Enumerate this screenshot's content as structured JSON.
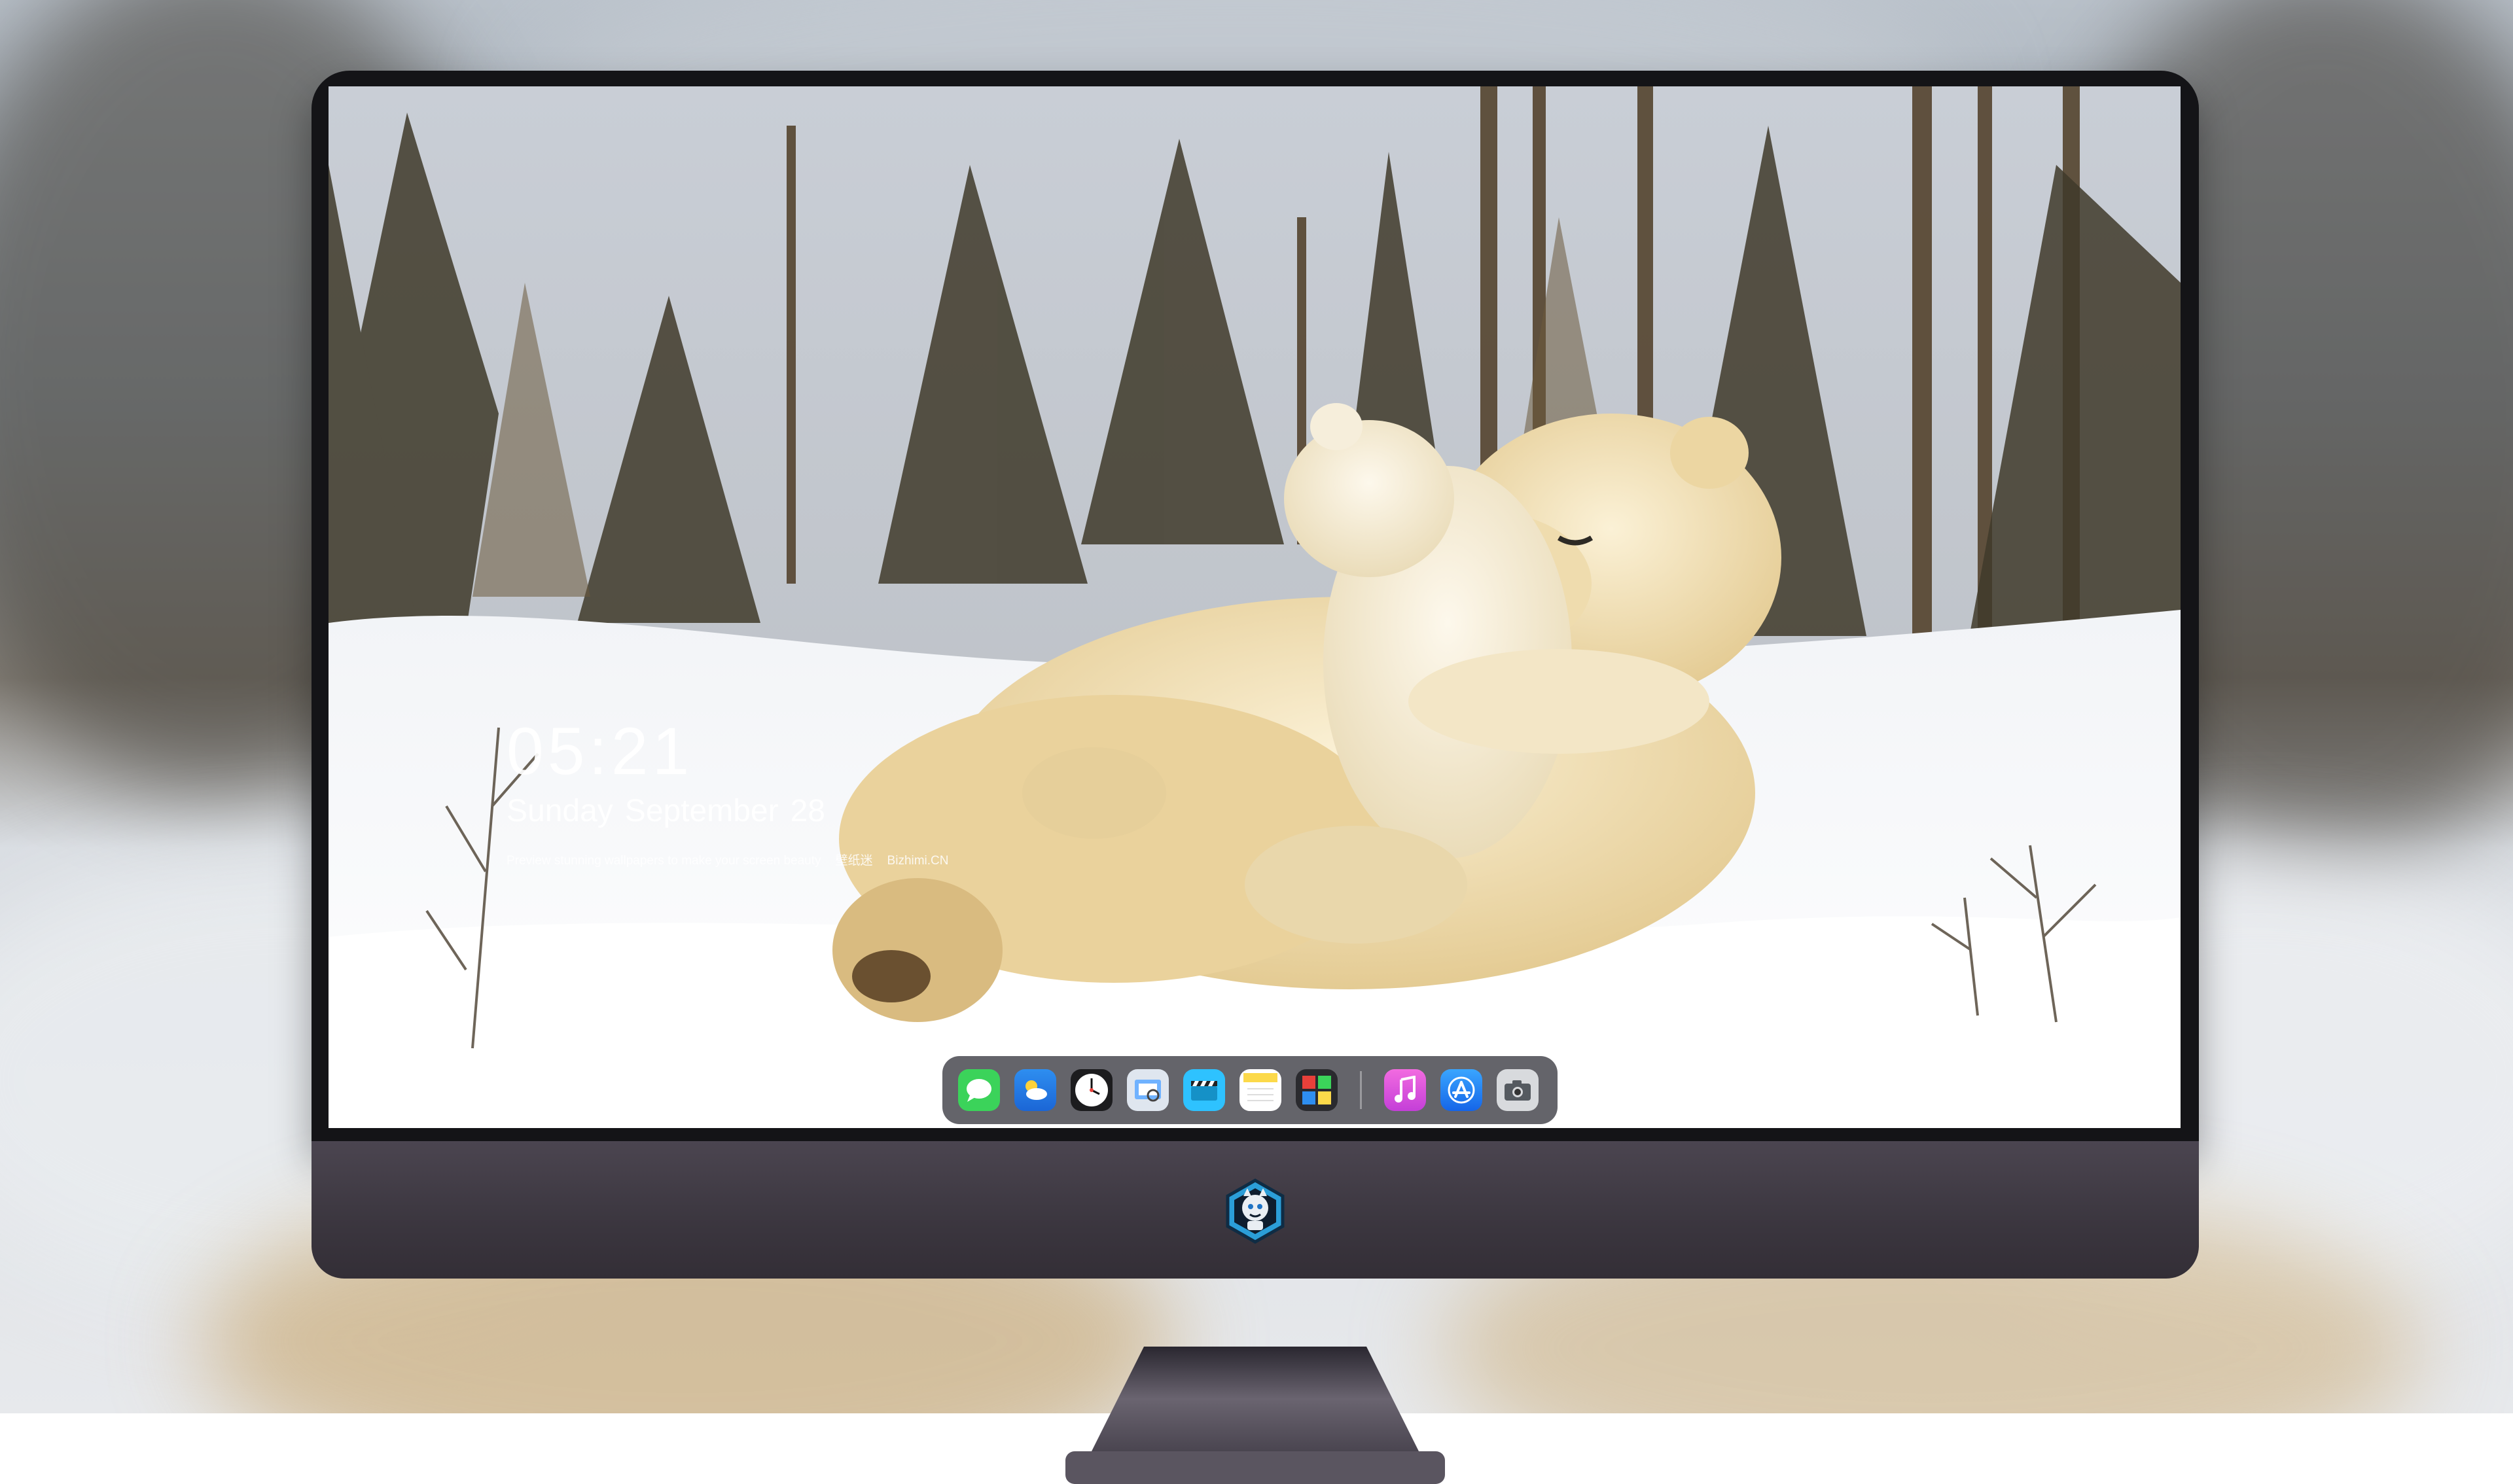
{
  "lockscreen": {
    "time": "05:21",
    "date": {
      "weekday": "Sunday",
      "month": "September",
      "day": "28"
    },
    "caption": {
      "text": "Preview stunning wallpapers to make your screen beauty",
      "brand_cn": "壁纸迷",
      "brand": "Bizhimi.CN"
    }
  },
  "dock": {
    "apps": [
      {
        "name": "messages-icon",
        "color": "#3bd35a"
      },
      {
        "name": "weather-icon",
        "color": "#2e8ef0"
      },
      {
        "name": "clock-icon",
        "color": "#ffffff"
      },
      {
        "name": "preview-icon",
        "color": "#6fb2ff"
      },
      {
        "name": "clips-icon",
        "color": "#2ec2ff"
      },
      {
        "name": "notes-icon",
        "color": "#fcd94a"
      },
      {
        "name": "photo-booth-icon",
        "color": "#e8403a"
      },
      {
        "name": "music-icon",
        "color": "#f054d8"
      },
      {
        "name": "app-store-icon",
        "color": "#1e8bff"
      },
      {
        "name": "camera-icon",
        "color": "#555a60"
      }
    ]
  },
  "monitor": {
    "logo_icon": "mascot-badge-icon",
    "bezel_color": "#141417",
    "chin_color": "#3d3841"
  }
}
